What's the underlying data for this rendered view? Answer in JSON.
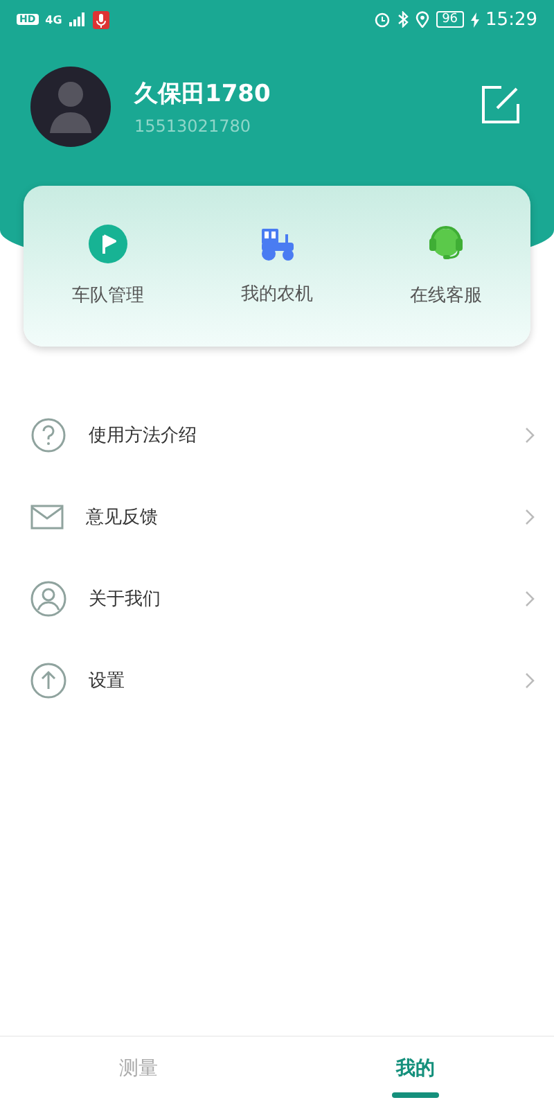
{
  "status_bar": {
    "hd": "HD",
    "network": "4G",
    "battery": "96",
    "time": "15:29"
  },
  "profile": {
    "name": "久保田1780",
    "phone": "15513021780"
  },
  "quick_actions": [
    {
      "kind": "flag",
      "label": "车队管理"
    },
    {
      "kind": "tractor",
      "label": "我的农机"
    },
    {
      "kind": "headset",
      "label": "在线客服"
    }
  ],
  "menu": [
    {
      "kind": "help",
      "label": "使用方法介绍"
    },
    {
      "kind": "mail",
      "label": "意见反馈"
    },
    {
      "kind": "user",
      "label": "关于我们"
    },
    {
      "kind": "upload",
      "label": "设置"
    }
  ],
  "tabs": [
    {
      "label": "测量",
      "selected": false
    },
    {
      "label": "我的",
      "selected": true
    }
  ]
}
